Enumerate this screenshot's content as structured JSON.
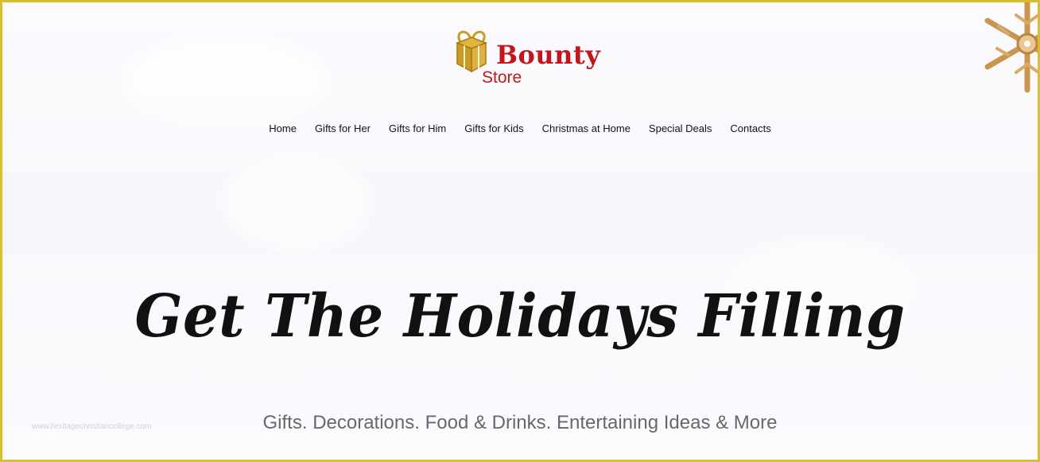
{
  "brand": {
    "name_top": "Bounty",
    "name_bottom": "Store",
    "logo_icon": "gift-box-icon"
  },
  "nav": {
    "items": [
      "Home",
      "Gifts for Her",
      "Gifts for Him",
      "Gifts for Kids",
      "Christmas at Home",
      "Special Deals",
      "Contacts"
    ]
  },
  "hero": {
    "title": "Get The Holidays Filling",
    "subtitle": "Gifts. Decorations. Food & Drinks. Entertaining Ideas & More"
  },
  "watermark": {
    "text": "www.heritagechristiancollege.com"
  },
  "decor": {
    "corner_icon": "snowflake-ornament-icon"
  },
  "colors": {
    "brand_red": "#c2161c",
    "gold": "#c99a24",
    "border": "#d9bf2b",
    "background": "#fbfbfe"
  }
}
